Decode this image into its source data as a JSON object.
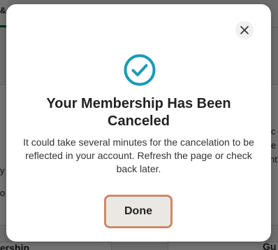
{
  "background": {
    "tab_label": "&",
    "fragments": {
      "left_y": "y",
      "left_o": "o",
      "left_bottom": "ership",
      "right_c": "c",
      "right_e": "e",
      "right_nt": "nt",
      "right_bottom": "Gu"
    }
  },
  "modal": {
    "close_label": "×",
    "title_line1": "Your Membership Has Been",
    "title_line2": "Canceled",
    "message": "It could take several minutes for the cancelation to be reflected in your account. Refresh the page or check back later.",
    "done_label": "Done"
  },
  "colors": {
    "accent_check": "#1a9bb5",
    "done_border": "#c98a6a",
    "done_bg": "#ebe8e3",
    "tab_underline": "#0a6d3a"
  },
  "icons": {
    "status": "check-circle-icon",
    "close": "close-icon"
  }
}
